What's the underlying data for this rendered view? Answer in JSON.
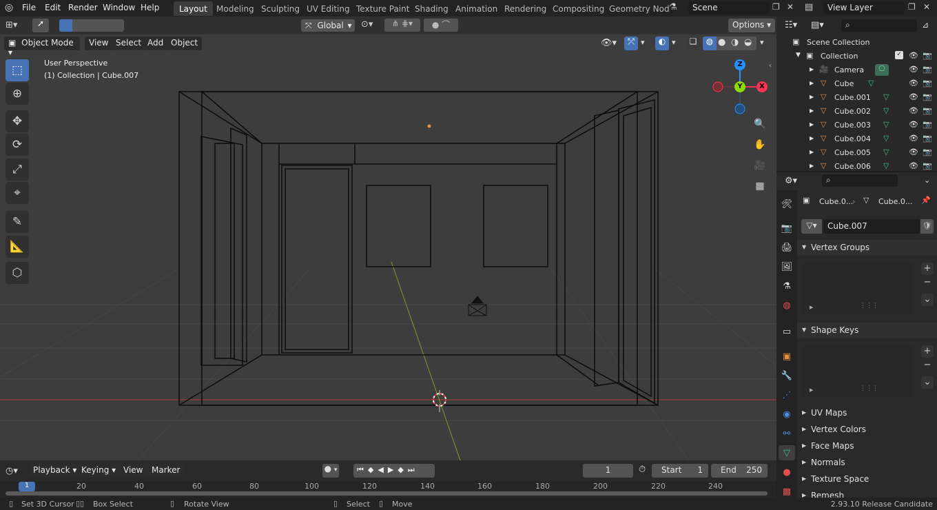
{
  "topbar": {
    "menus": [
      "File",
      "Edit",
      "Render",
      "Window",
      "Help"
    ],
    "workspaces": [
      "Layout",
      "Modeling",
      "Sculpting",
      "UV Editing",
      "Texture Paint",
      "Shading",
      "Animation",
      "Rendering",
      "Compositing",
      "Geometry Nod"
    ],
    "scene": "Scene",
    "view_layer": "View Layer"
  },
  "tool_header": {
    "transform_orientation": "Global",
    "options": "Options"
  },
  "viewport_header": {
    "mode": "Object Mode",
    "menus": [
      "View",
      "Select",
      "Add",
      "Object"
    ]
  },
  "viewport": {
    "perspective": "User Perspective",
    "context": "(1) Collection | Cube.007",
    "gizmo_labels": {
      "z": "Z",
      "y": "Y",
      "x": "X"
    }
  },
  "outliner": {
    "scene_collection": "Scene Collection",
    "collection": "Collection",
    "items": [
      "Camera",
      "Cube",
      "Cube.001",
      "Cube.002",
      "Cube.003",
      "Cube.004",
      "Cube.005",
      "Cube.006"
    ]
  },
  "properties": {
    "breadcrumb_object": "Cube.0...",
    "breadcrumb_mesh": "Cube.0...",
    "mesh_name": "Cube.007",
    "panels_open": [
      "Vertex Groups",
      "Shape Keys"
    ],
    "panels_closed": [
      "UV Maps",
      "Vertex Colors",
      "Face Maps",
      "Normals",
      "Texture Space",
      "Remesh"
    ]
  },
  "timeline": {
    "menus": [
      "Playback",
      "Keying",
      "View",
      "Marker"
    ],
    "current_frame": "1",
    "start_label": "Start",
    "start_value": "1",
    "end_label": "End",
    "end_value": "250",
    "ticks": [
      "1",
      "20",
      "40",
      "60",
      "80",
      "100",
      "120",
      "140",
      "160",
      "180",
      "200",
      "220",
      "240"
    ]
  },
  "status_bar": {
    "set_cursor": "Set 3D Cursor",
    "box_select": "Box Select",
    "rotate_view": "Rotate View",
    "select": "Select",
    "move": "Move",
    "version": "2.93.10 Release Candidate"
  },
  "colors": {
    "accent": "#4772b3",
    "x_axis": "#ff3352",
    "y_axis": "#8bdc00",
    "z_axis": "#2890ff",
    "mesh_green": "#40c080",
    "object_orange": "#e8903c"
  }
}
